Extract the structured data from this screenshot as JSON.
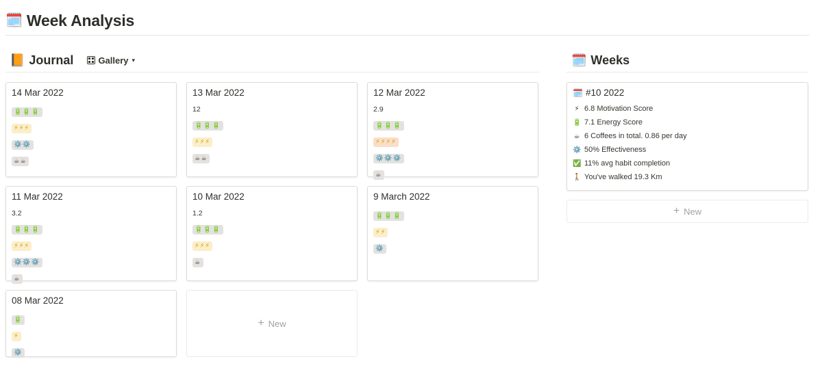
{
  "page": {
    "title": "Week Analysis",
    "icon": "calendar-icon",
    "icon_glyph": "🗓️"
  },
  "journal": {
    "title": "Journal",
    "icon": "link-book-icon",
    "icon_glyph": "📙",
    "view": {
      "label": "Gallery",
      "icon": "gallery-grid-icon",
      "chevron": "⌄"
    },
    "cards": [
      {
        "title": "14 Mar 2022",
        "number": "",
        "energy": "🔋🔋🔋",
        "motivation": "⚡⚡⚡",
        "motivation_color": "yellow",
        "effectiveness": "⚙️⚙️",
        "coffee": "☕☕"
      },
      {
        "title": "13 Mar 2022",
        "number": "12",
        "energy": "🔋🔋🔋",
        "motivation": "⚡⚡⚡",
        "motivation_color": "yellow",
        "effectiveness": "",
        "coffee": "☕☕"
      },
      {
        "title": "12 Mar 2022",
        "number": "2.9",
        "energy": "🔋🔋🔋",
        "motivation": "⚡⚡⚡⚡",
        "motivation_color": "orange",
        "effectiveness": "⚙️⚙️⚙️",
        "coffee": "☕"
      },
      {
        "title": "11 Mar 2022",
        "number": "3.2",
        "energy": "🔋🔋🔋",
        "motivation": "⚡⚡⚡",
        "motivation_color": "yellow",
        "effectiveness": "⚙️⚙️⚙️",
        "coffee": "☕"
      },
      {
        "title": "10 Mar 2022",
        "number": "1.2",
        "energy": "🔋🔋🔋",
        "motivation": "⚡⚡⚡",
        "motivation_color": "yellow",
        "effectiveness": "",
        "coffee": "☕"
      },
      {
        "title": "9 March 2022",
        "number": "",
        "energy": "🔋🔋🔋",
        "motivation": "⚡⚡",
        "motivation_color": "yellow",
        "effectiveness": "⚙️",
        "coffee": ""
      },
      {
        "title": "08 Mar 2022",
        "number": "",
        "energy": "🔋",
        "motivation": "⚡",
        "motivation_color": "yellow",
        "effectiveness": "⚙️",
        "coffee": ""
      }
    ],
    "new_label": "New",
    "new_icon": "plus-icon"
  },
  "weeks": {
    "title": "Weeks",
    "icon": "link-calendar-icon",
    "icon_glyph": "🗓️",
    "card": {
      "title": "#10 2022",
      "title_icon": "🗓️",
      "stats": [
        {
          "icon": "⚡",
          "icon_name": "lightning-icon",
          "text": "6.8 Motivation Score"
        },
        {
          "icon": "🔋",
          "icon_name": "battery-icon",
          "text": "7.1 Energy Score"
        },
        {
          "icon": "☕",
          "icon_name": "coffee-icon",
          "text": "6 Coffees in total. 0.86 per day"
        },
        {
          "icon": "⚙️",
          "icon_name": "gear-icon",
          "text": "50% Effectiveness"
        },
        {
          "icon": "✅",
          "icon_name": "check-icon",
          "text": "11% avg habit completion"
        },
        {
          "icon": "🚶",
          "icon_name": "walking-icon",
          "text": "You've walked 19.3 Km"
        }
      ]
    },
    "new_label": "New"
  }
}
